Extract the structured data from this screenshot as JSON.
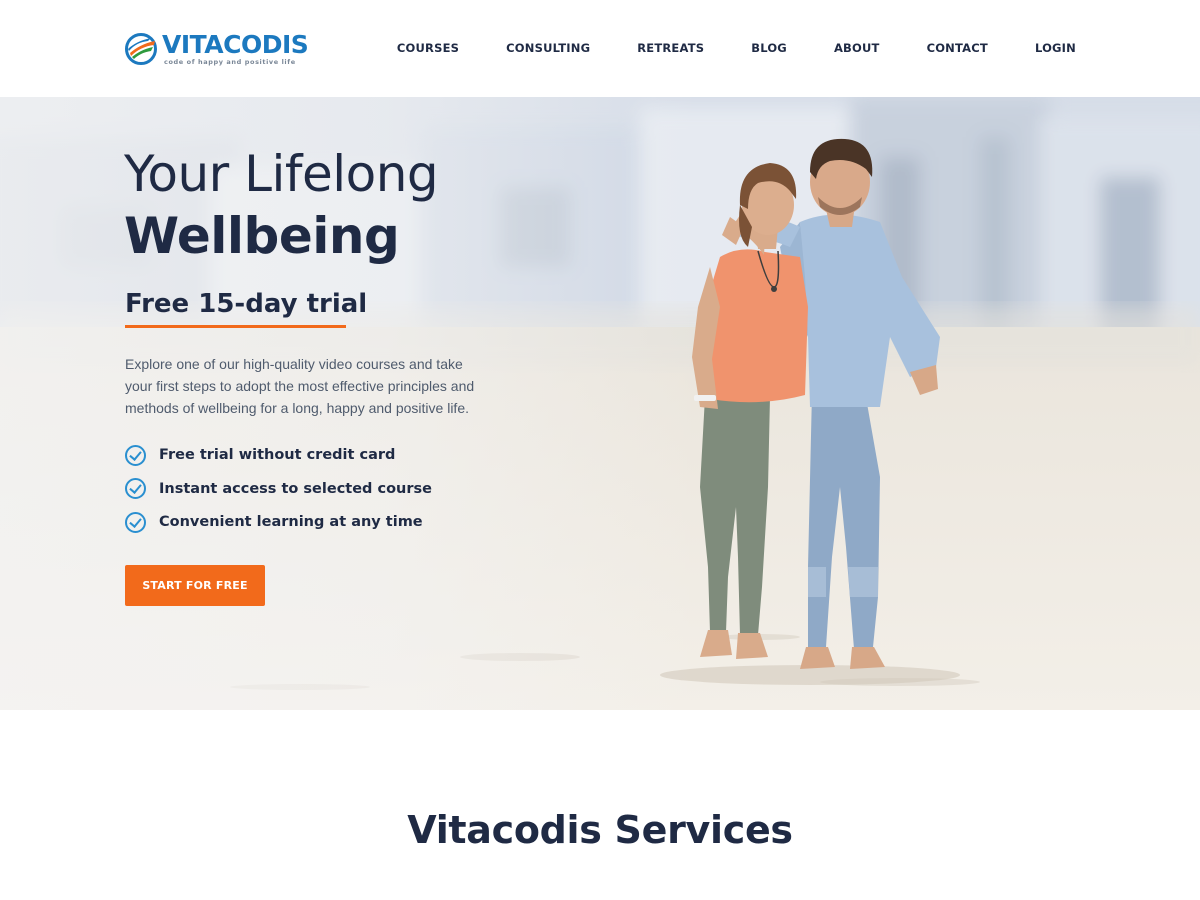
{
  "brand": {
    "name": "VITACODIS",
    "tagline": "code of happy and positive life",
    "colors": {
      "primary_blue": "#1c79bf",
      "accent_orange": "#f26a1b",
      "dark_text": "#1f2a44",
      "check_blue": "#2a8fd0"
    }
  },
  "nav": {
    "items": [
      {
        "label": "COURSES"
      },
      {
        "label": "CONSULTING"
      },
      {
        "label": "RETREATS"
      },
      {
        "label": "BLOG"
      },
      {
        "label": "ABOUT"
      },
      {
        "label": "CONTACT"
      },
      {
        "label": "LOGIN"
      }
    ]
  },
  "hero": {
    "title_line1": "Your Lifelong",
    "title_line2": "Wellbeing",
    "subtitle": "Free 15-day trial",
    "description": "Explore one of our high-quality video courses and take your first steps to adopt the most effective principles and methods of wellbeing for a long, happy and positive life.",
    "features": [
      {
        "text": "Free trial without credit card",
        "icon": "check-circle-icon"
      },
      {
        "text": "Instant access to selected course",
        "icon": "check-circle-icon"
      },
      {
        "text": "Convenient learning at any time",
        "icon": "check-circle-icon"
      }
    ],
    "cta_label": "START FOR FREE",
    "image": "couple-walking-on-beach"
  },
  "services": {
    "title_light": "Vitacodis",
    "title_bold": "Services"
  }
}
